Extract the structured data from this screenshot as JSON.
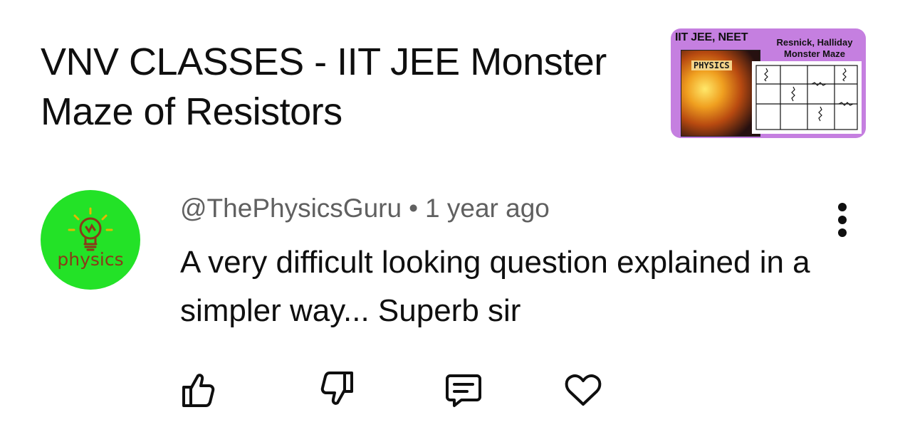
{
  "video": {
    "title": "VNV CLASSES - IIT JEE Monster Maze of Resistors",
    "thumbnail": {
      "tag": "IIT JEE, NEET",
      "subtitle_line1": "Resnick, Halliday",
      "subtitle_line2": "Monster Maze",
      "book_label": "PHYSICS",
      "background_color": "#c57fe0"
    }
  },
  "comment": {
    "avatar": {
      "text": "physics",
      "color": "#23e227",
      "icon": "lightbulb-icon"
    },
    "author": "@ThePhysicsGuru",
    "separator": "•",
    "time": "1 year ago",
    "text": "A very difficult looking question explained in a simpler way... Superb sir",
    "actions": [
      {
        "name": "like",
        "icon": "thumbs-up-icon"
      },
      {
        "name": "dislike",
        "icon": "thumbs-down-icon"
      },
      {
        "name": "reply",
        "icon": "comment-icon"
      },
      {
        "name": "heart",
        "icon": "heart-icon"
      }
    ],
    "more_icon": "more-vertical-icon"
  }
}
